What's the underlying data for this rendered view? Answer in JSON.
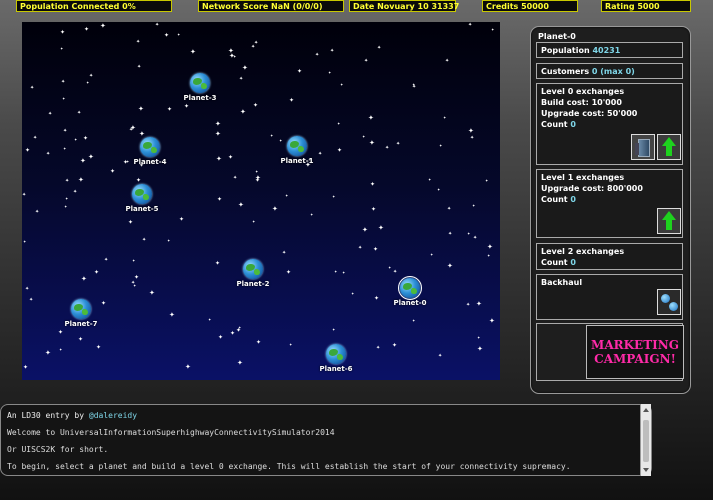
{
  "status": {
    "population": "Population Connected 0%",
    "network": "Network Score NaN (0/0/0)",
    "date": "Date Novuary 10 31337",
    "credits": "Credits 50000",
    "rating": "Rating 5000"
  },
  "planets": [
    {
      "name": "Planet-0",
      "selected": true
    },
    {
      "name": "Planet-1",
      "selected": false
    },
    {
      "name": "Planet-2",
      "selected": false
    },
    {
      "name": "Planet-3",
      "selected": false
    },
    {
      "name": "Planet-4",
      "selected": false
    },
    {
      "name": "Planet-5",
      "selected": false
    },
    {
      "name": "Planet-6",
      "selected": false
    },
    {
      "name": "Planet-7",
      "selected": false
    }
  ],
  "panel": {
    "title": "Planet-0",
    "population_label": "Population",
    "population_value": "40231",
    "customers_label": "Customers",
    "customers_value": "0 (max 0)",
    "level0": {
      "title": "Level 0 exchanges",
      "build_cost": "Build cost: 10'000",
      "upgrade_cost": "Upgrade cost: 50'000",
      "count_label": "Count",
      "count_value": "0"
    },
    "level1": {
      "title": "Level 1 exchanges",
      "upgrade_cost": "Upgrade cost: 800'000",
      "count_label": "Count",
      "count_value": "0"
    },
    "level2": {
      "title": "Level 2 exchanges",
      "count_label": "Count",
      "count_value": "0"
    },
    "backhaul": "Backhaul",
    "marketing_line1": "MARKETING",
    "marketing_line2": "CAMPAIGN!"
  },
  "console": {
    "line1_prefix": "An LD30 entry by",
    "line1_handle": "@dalereidy",
    "line2": "Welcome to UniversalInformationSuperhighwayConnectivitySimulator2014",
    "line3": "Or UISCS2K for short.",
    "line4": "To begin, select a planet and build a level 0 exchange. This will establish the start of your connectivity supremacy."
  },
  "colors": {
    "status_text": "#ffff33",
    "value_text": "#7fd6e8",
    "marketing_text": "#ff2aa8",
    "upgrade_arrow": "#1ed21e"
  },
  "icons": [
    "server-icon",
    "upgrade-arrow-icon",
    "backhaul-icon",
    "planet-globe-icon",
    "star-icon"
  ]
}
